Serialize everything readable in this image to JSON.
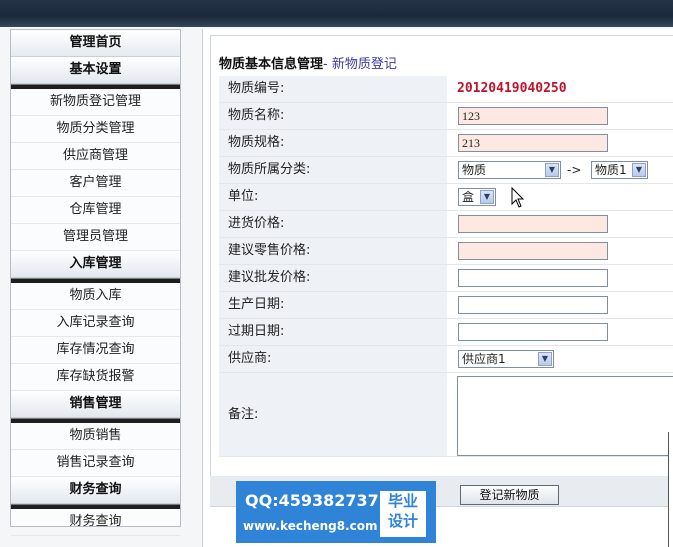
{
  "sidebar": {
    "top_items": [
      {
        "label": "管理首页"
      },
      {
        "label": "基本设置"
      }
    ],
    "basic_items": [
      {
        "label": "新物质登记管理"
      },
      {
        "label": "物质分类管理"
      },
      {
        "label": "供应商管理"
      },
      {
        "label": "客户管理"
      },
      {
        "label": "仓库管理"
      },
      {
        "label": "管理员管理"
      }
    ],
    "inbound_title": "入库管理",
    "inbound_items": [
      {
        "label": "物质入库"
      },
      {
        "label": "入库记录查询"
      },
      {
        "label": "库存情况查询"
      },
      {
        "label": "库存缺货报警"
      }
    ],
    "sales_title": "销售管理",
    "sales_items": [
      {
        "label": "物质销售"
      },
      {
        "label": "销售记录查询"
      }
    ],
    "finance_title": "财务查询",
    "finance_items": [
      {
        "label": "财务查询"
      }
    ]
  },
  "form": {
    "title": "物质基本信息管理",
    "subtitle_separator": "- ",
    "subtitle": "新物质登记",
    "fields": {
      "code": {
        "label": "物质编号:",
        "value": "20120419040250"
      },
      "name": {
        "label": "物质名称:",
        "value": "123"
      },
      "spec": {
        "label": "物质规格:",
        "value": "213"
      },
      "category": {
        "label": "物质所属分类:",
        "value": "物质",
        "arrow_text": "->",
        "sub_value": "物质1"
      },
      "unit": {
        "label": "单位:",
        "value": "盒"
      },
      "purchase_price": {
        "label": "进货价格:",
        "value": ""
      },
      "retail_price": {
        "label": "建议零售价格:",
        "value": ""
      },
      "wholesale_price": {
        "label": "建议批发价格:",
        "value": ""
      },
      "production_date": {
        "label": "生产日期:",
        "value": ""
      },
      "expiry_date": {
        "label": "过期日期:",
        "value": ""
      },
      "supplier": {
        "label": "供应商:",
        "value": "供应商1"
      },
      "remark": {
        "label": "备注:",
        "value": ""
      }
    },
    "submit_label": "登记新物质"
  },
  "watermark": {
    "qq": "QQ:459382737",
    "url": "www.kecheng8.com",
    "badge_line1": "毕业",
    "badge_line2": "设计"
  }
}
